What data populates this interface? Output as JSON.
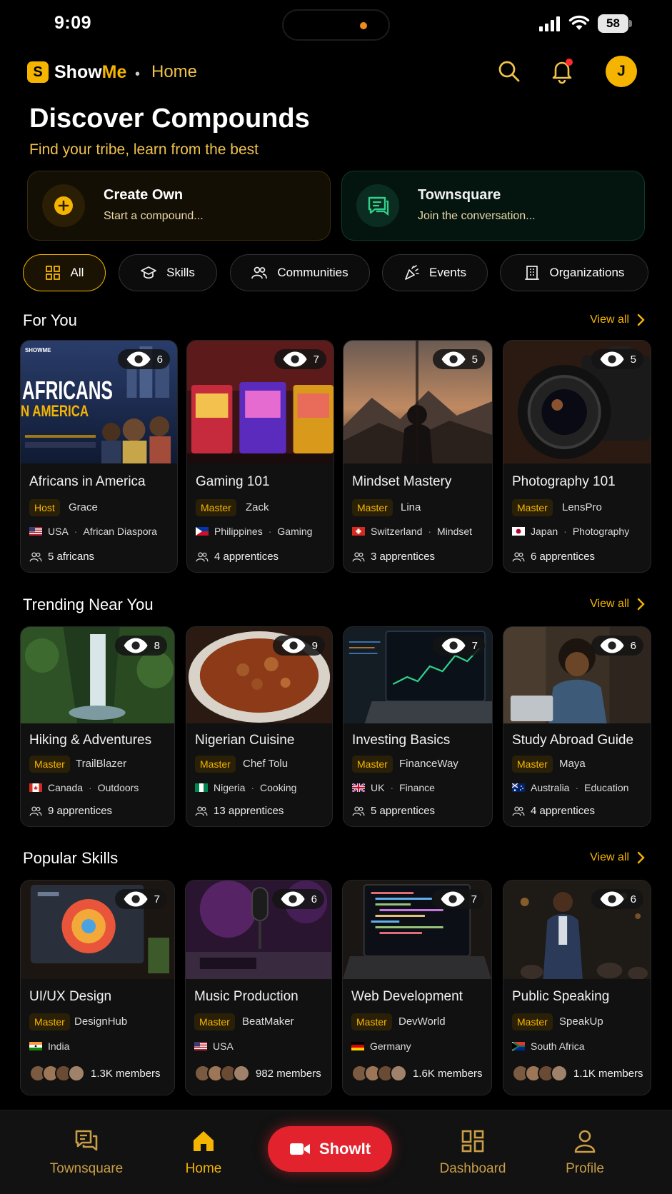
{
  "status_bar": {
    "time": "9:09",
    "battery": "58"
  },
  "header": {
    "brand_show": "Show",
    "brand_me": "Me",
    "logo_letter": "S",
    "crumb": "Home",
    "avatar_letter": "J"
  },
  "hero": {
    "title": "Discover Compounds",
    "subtitle": "Find your tribe, learn from the best"
  },
  "actions": {
    "create": {
      "title": "Create Own",
      "subtitle": "Start a compound..."
    },
    "townsquare": {
      "title": "Townsquare",
      "subtitle": "Join the conversation..."
    }
  },
  "filters": [
    {
      "label": "All",
      "icon": "grid-icon",
      "active": true
    },
    {
      "label": "Skills",
      "icon": "graduation-cap-icon"
    },
    {
      "label": "Communities",
      "icon": "users-icon"
    },
    {
      "label": "Events",
      "icon": "party-popper-icon"
    },
    {
      "label": "Organizations",
      "icon": "building-icon"
    }
  ],
  "sections": {
    "for_you": {
      "title": "For You",
      "view_all": "View all",
      "cards": [
        {
          "title": "Africans in America",
          "views": "6",
          "role": "Host",
          "host": "Grace",
          "country": "USA",
          "category": "African Diaspora",
          "meta": "5 africans",
          "image_text_1": "AFRICANS",
          "image_text_2": "N AMERICA",
          "image_brand": "SHOWME"
        },
        {
          "title": "Gaming 101",
          "views": "7",
          "role": "Master",
          "host": "Zack",
          "country": "Philippines",
          "category": "Gaming",
          "meta": "4 apprentices"
        },
        {
          "title": "Mindset Mastery",
          "views": "5",
          "role": "Master",
          "host": "Lina",
          "country": "Switzerland",
          "category": "Mindset",
          "meta": "3 apprentices"
        },
        {
          "title": "Photography 101",
          "views": "5",
          "role": "Master",
          "host": "LensPro",
          "country": "Japan",
          "category": "Photography",
          "meta": "6 apprentices"
        }
      ]
    },
    "trending": {
      "title": "Trending Near You",
      "view_all": "View all",
      "cards": [
        {
          "title": "Hiking & Adventures",
          "views": "8",
          "role": "Master",
          "host": "TrailBlazer",
          "country": "Canada",
          "category": "Outdoors",
          "meta": "9 apprentices"
        },
        {
          "title": "Nigerian Cuisine",
          "views": "9",
          "role": "Master",
          "host": "Chef Tolu",
          "country": "Nigeria",
          "category": "Cooking",
          "meta": "13 apprentices"
        },
        {
          "title": "Investing Basics",
          "views": "7",
          "role": "Master",
          "host": "FinanceWay",
          "country": "UK",
          "category": "Finance",
          "meta": "5 apprentices"
        },
        {
          "title": "Study Abroad Guide",
          "views": "6",
          "role": "Master",
          "host": "Maya",
          "country": "Australia",
          "category": "Education",
          "meta": "4 apprentices"
        }
      ]
    },
    "popular": {
      "title": "Popular Skills",
      "view_all": "View all",
      "cards": [
        {
          "title": "UI/UX Design",
          "views": "7",
          "role": "Master",
          "host": "DesignHub",
          "country": "India",
          "meta": "1.3K members"
        },
        {
          "title": "Music Production",
          "views": "6",
          "role": "Master",
          "host": "BeatMaker",
          "country": "USA",
          "meta": "982 members"
        },
        {
          "title": "Web Development",
          "views": "7",
          "role": "Master",
          "host": "DevWorld",
          "country": "Germany",
          "meta": "1.6K members"
        },
        {
          "title": "Public Speaking",
          "views": "6",
          "role": "Master",
          "host": "SpeakUp",
          "country": "South Africa",
          "meta": "1.1K members"
        }
      ]
    }
  },
  "bottom_nav": {
    "townsquare": "Townsquare",
    "home": "Home",
    "showit": "ShowIt",
    "dashboard": "Dashboard",
    "profile": "Profile"
  },
  "colors": {
    "accent": "#f5b400",
    "showit": "#e2232e",
    "background": "#000000"
  }
}
